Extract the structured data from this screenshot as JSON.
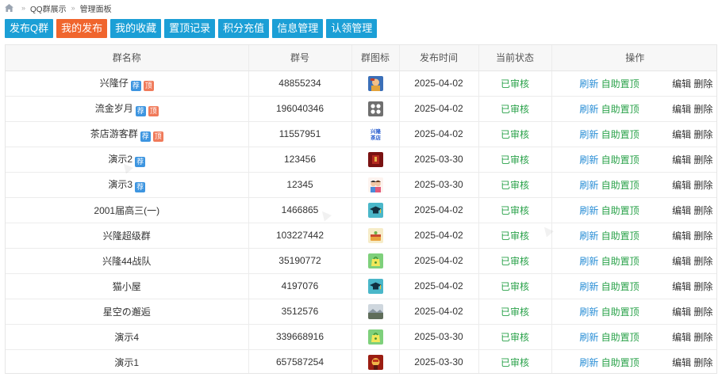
{
  "breadcrumb": {
    "items": [
      "QQ群展示",
      "管理面板"
    ]
  },
  "tabs": [
    {
      "label": "发布Q群",
      "active": false
    },
    {
      "label": "我的发布",
      "active": true
    },
    {
      "label": "我的收藏",
      "active": false
    },
    {
      "label": "置顶记录",
      "active": false
    },
    {
      "label": "积分充值",
      "active": false
    },
    {
      "label": "信息管理",
      "active": false
    },
    {
      "label": "认领管理",
      "active": false
    }
  ],
  "table": {
    "headers": {
      "name": "群名称",
      "number": "群号",
      "icon": "群图标",
      "time": "发布时间",
      "status": "当前状态",
      "ops": "操作"
    },
    "badge_rec": "荐",
    "badge_top": "顶",
    "actions": {
      "refresh": "刷新",
      "auto_top": "自助置顶",
      "edit": "编辑",
      "delete": "删除"
    },
    "rows": [
      {
        "name": "兴隆仔",
        "rec": true,
        "top": true,
        "number": "48855234",
        "icon": "avatar-blue-icon",
        "time": "2025-04-02",
        "status": "已审核"
      },
      {
        "name": "流金岁月",
        "rec": true,
        "top": true,
        "number": "196040346",
        "icon": "group-gray-icon",
        "time": "2025-04-02",
        "status": "已审核"
      },
      {
        "name": "茶店游客群",
        "rec": true,
        "top": true,
        "number": "11557951",
        "icon": "xinglong-text-icon",
        "time": "2025-04-02",
        "status": "已审核"
      },
      {
        "name": "演示2",
        "rec": true,
        "top": false,
        "number": "123456",
        "icon": "red-dark-icon",
        "time": "2025-03-30",
        "status": "已审核"
      },
      {
        "name": "演示3",
        "rec": true,
        "top": false,
        "number": "12345",
        "icon": "couple-icon",
        "time": "2025-03-30",
        "status": "已审核"
      },
      {
        "name": "2001届高三(一)",
        "rec": false,
        "top": false,
        "number": "1466865",
        "icon": "graduation-cap-icon",
        "time": "2025-04-02",
        "status": "已审核"
      },
      {
        "name": "兴隆超级群",
        "rec": false,
        "top": false,
        "number": "103227442",
        "icon": "cake-icon",
        "time": "2025-04-02",
        "status": "已审核"
      },
      {
        "name": "兴隆44战队",
        "rec": false,
        "top": false,
        "number": "35190772",
        "icon": "green-bag-icon",
        "time": "2025-04-02",
        "status": "已审核"
      },
      {
        "name": "猫小屋",
        "rec": false,
        "top": false,
        "number": "4197076",
        "icon": "graduation-cap-icon",
        "time": "2025-04-02",
        "status": "已审核"
      },
      {
        "name": "星空の邂逅",
        "rec": false,
        "top": false,
        "number": "3512576",
        "icon": "landscape-icon",
        "time": "2025-04-02",
        "status": "已审核"
      },
      {
        "name": "演示4",
        "rec": false,
        "top": false,
        "number": "339668916",
        "icon": "green-bag-icon",
        "time": "2025-03-30",
        "status": "已审核"
      },
      {
        "name": "演示1",
        "rec": false,
        "top": false,
        "number": "657587254",
        "icon": "warrior-icon",
        "time": "2025-03-30",
        "status": "已审核"
      }
    ]
  },
  "colors": {
    "tab": "#1b9fd6",
    "tab_active": "#f0652d",
    "status": "#2aa24a",
    "link": "#2b8fd6"
  }
}
